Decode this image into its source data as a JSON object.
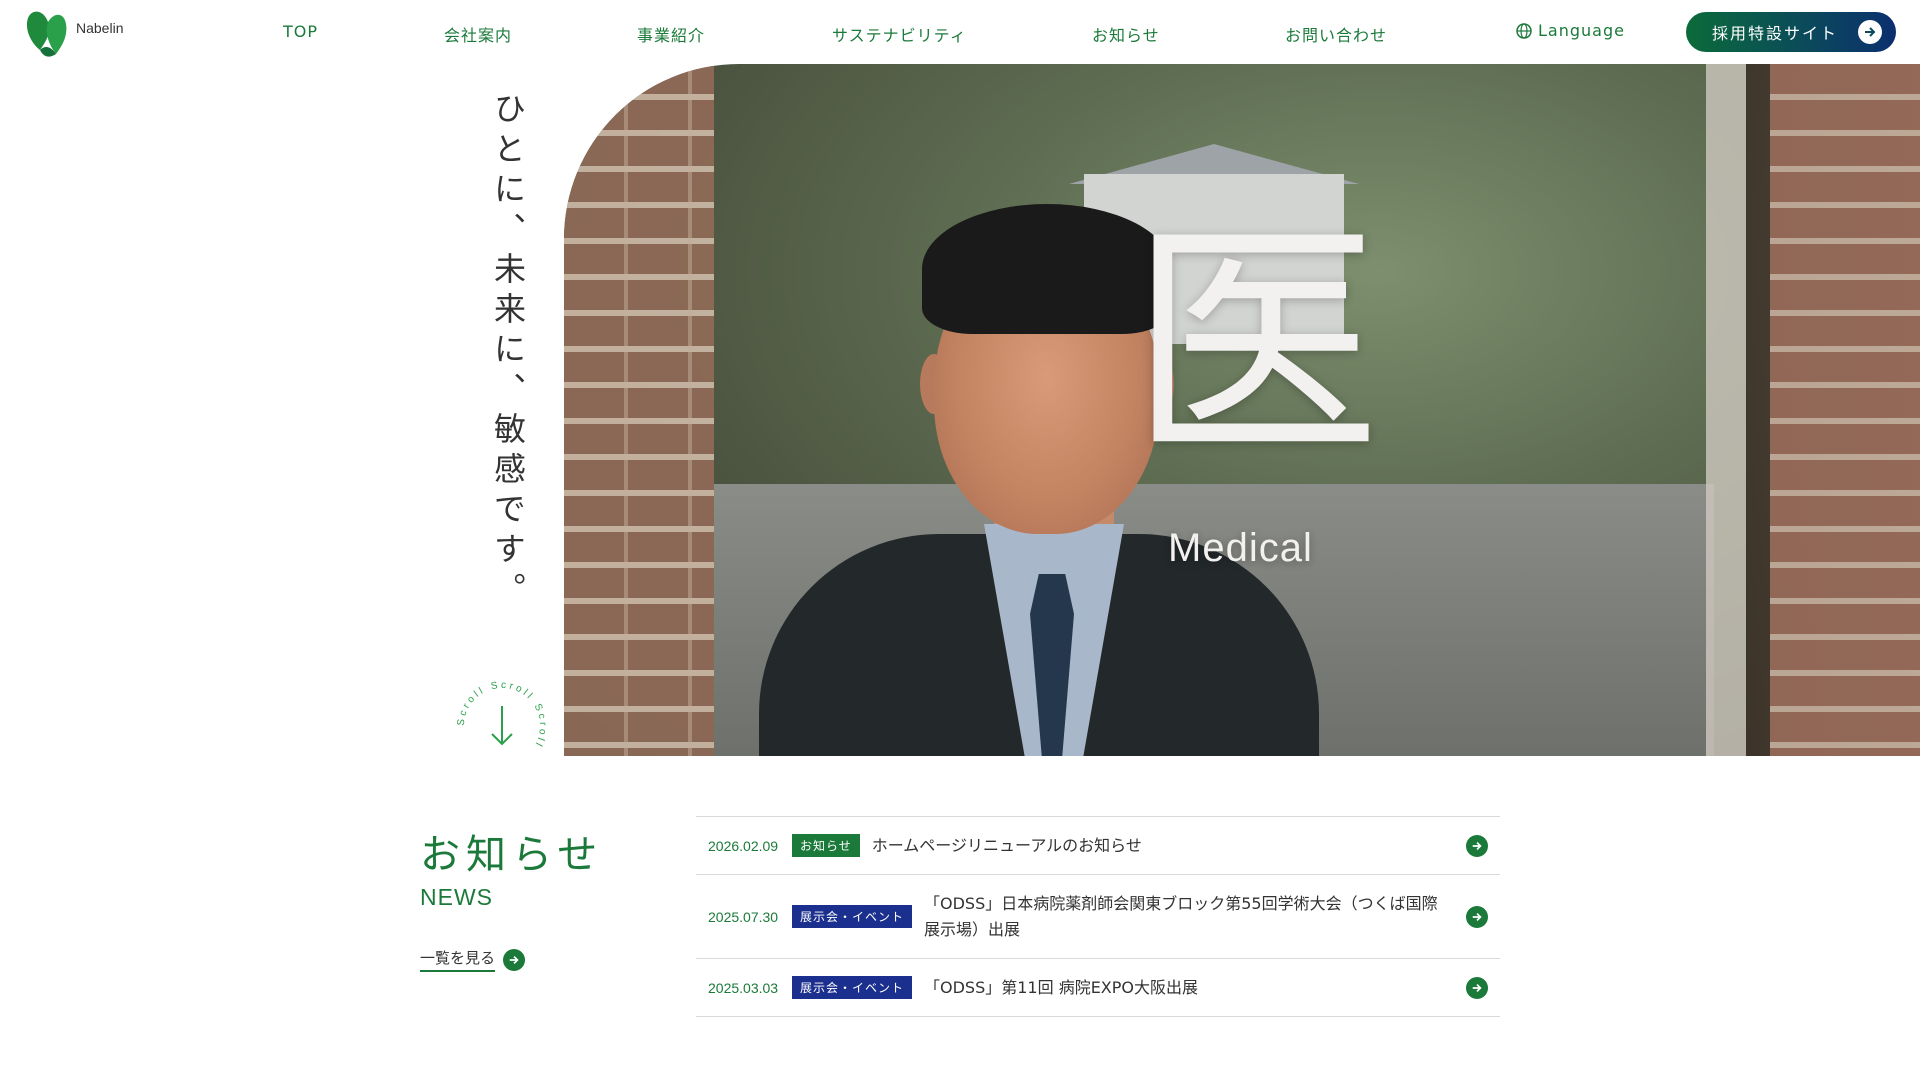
{
  "header": {
    "logo_text": "Nabelin",
    "nav": [
      "TOP",
      "会社案内",
      "事業紹介",
      "サステナビリティ",
      "お知らせ",
      "お問い合わせ"
    ],
    "language_label": "Language",
    "recruit_label": "採用特設サイト"
  },
  "hero": {
    "tagline": "ひとに、未来に、敏感です。",
    "kanji": "医",
    "kanji_en": "Medical",
    "scroll_label": "Scroll Scroll Scroll"
  },
  "news": {
    "title": "お知らせ",
    "subtitle": "NEWS",
    "more_label": "一覧を見る",
    "items": [
      {
        "date": "2026.02.09",
        "tag": "お知らせ",
        "text": "ホームページリニューアルのお知らせ"
      },
      {
        "date": "2025.07.30",
        "tag": "展示会・イベント",
        "text": "「ODSS」日本病院薬剤師会関東ブロック第55回学術大会（つくば国際展示場）出展"
      },
      {
        "date": "2025.03.03",
        "tag": "展示会・イベント",
        "text": "「ODSS」第11回 病院EXPO大阪出展"
      }
    ]
  },
  "colors": {
    "brand_green": "#1b7a3a",
    "tag_blue": "#1a2f8e"
  },
  "icons": [
    "logo-leaf-icon",
    "globe-icon",
    "arrow-right-icon",
    "arrow-down-icon"
  ]
}
